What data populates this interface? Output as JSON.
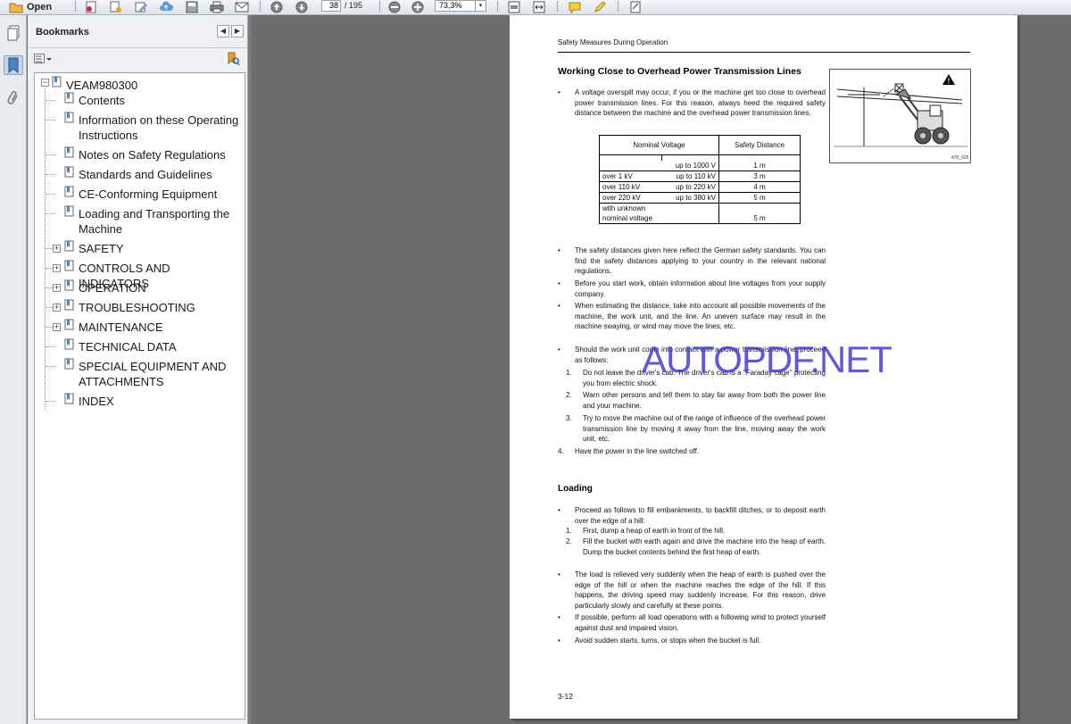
{
  "toolbar": {
    "open_label": "Open",
    "page_current": "38",
    "page_total": "/ 195",
    "zoom_value": "73,3%",
    "zoom_dropdown": "▾"
  },
  "sidebar_strip": {
    "pages_icon": "pages-icon",
    "bookmarks_icon": "bookmark-ribbon-icon",
    "attachments_icon": "paperclip-icon"
  },
  "bookmarks_panel": {
    "title": "Bookmarks",
    "collapse_icon": "◀",
    "expand_icon": "▶",
    "options_icon": "options-icon",
    "find_icon": "find-bookmark-icon",
    "root": "VEAM980300",
    "items": [
      {
        "label": "Contents",
        "expandable": false
      },
      {
        "label": "Information on these Operating Instructions",
        "expandable": false
      },
      {
        "label": "Notes on Safety Regulations",
        "expandable": false
      },
      {
        "label": "Standards and Guidelines",
        "expandable": false
      },
      {
        "label": "CE-Conforming Equipment",
        "expandable": false
      },
      {
        "label": "Loading and Transporting the Machine",
        "expandable": false
      },
      {
        "label": "SAFETY",
        "expandable": true
      },
      {
        "label": "CONTROLS AND INDICATORS",
        "expandable": true
      },
      {
        "label": "OPERATION",
        "expandable": true
      },
      {
        "label": "TROUBLESHOOTING",
        "expandable": true
      },
      {
        "label": "MAINTENANCE",
        "expandable": true
      },
      {
        "label": "TECHNICAL DATA",
        "expandable": false
      },
      {
        "label": "SPECIAL EQUIPMENT AND ATTACHMENTS",
        "expandable": false
      },
      {
        "label": "INDEX",
        "expandable": false
      }
    ]
  },
  "page": {
    "header": "Safety Measures During Operation",
    "section1_title": "Working Close to Overhead Power Transmission Lines",
    "intro_bullet": "A voltage overspill may occur, if you or the machine get too close to overhead power transmission lines. For this reason, always heed the required safety distance between the machine and the overhead power transmission lines.",
    "table": {
      "head_voltage": "Nominal Voltage",
      "head_distance": "Safety Distance",
      "rows": [
        {
          "from": "",
          "to": "up to 1000 V",
          "dist": "1 m"
        },
        {
          "from": "over      1 kV",
          "to": "up to 110 kV",
          "dist": "3 m"
        },
        {
          "from": "over 110 kV",
          "to": "up to 220 kV",
          "dist": "4 m"
        },
        {
          "from": "over 220 kV",
          "to": "up to 380 kV",
          "dist": "5 m"
        },
        {
          "from": "with unknown",
          "to": "",
          "dist": ""
        },
        {
          "from": "nominal voltage",
          "to": "",
          "dist": "5 m"
        }
      ]
    },
    "illustration_code": "470_025",
    "illustration_warning": "!",
    "bullets_a": [
      "The safety distances given here reflect the German safety standards. You can find the safety distances applying to your country in the relevant national regulations.",
      "Before you start work, obtain information about line voltages from your supply company.",
      "When estimating the distance, take into account all possible movements of the machine, the work unit, and the line. An uneven surface may result in the machine swaying, or wind may move the lines, etc.",
      "Should the work unit come into contact with a power transmission line, proceed as follows:"
    ],
    "steps_a": [
      "Do not leave the driver's cab. The driver's cab is a \"Faraday cage\" protecting you from electric shock.",
      "Warn other persons and tell them to stay far away from both the power line and your machine.",
      "Try to move the machine out of the range of influence of the overhead power transmission line by moving it away from the line, moving away the work unit, etc."
    ],
    "step_a4": "Have the power in the line switched off.",
    "section2_title": "Loading",
    "loading_bullet": "Proceed as follows to fill embankments, to backfill ditches, or to deposit earth over the edge of a hill:",
    "steps_b": [
      "First, dump a heap of earth in front of the hill.",
      "Fill the bucket with earth again and drive the machine into the heap of earth. Dump the bucket contents behind the first heap of earth."
    ],
    "bullets_b": [
      "The load is relieved very suddenly when the heap of earth is pushed over the edge of the hill or when the machine reaches the edge of the hill. If this happens, the driving speed may suddenly increase. For this reason, drive particularly slowly and carefully at these points.",
      "If possible, perform all load operations with a following wind to protect yourself against dust and impaired vision.",
      "Avoid sudden starts, turns, or stops when the bucket is full."
    ],
    "page_number": "3-12",
    "watermark": "AUTOPDF.NET"
  },
  "colors": {
    "watermark": "#4a3cd6",
    "panel_bg": "#eef0f3",
    "doc_bg": "#6d6d6d"
  }
}
